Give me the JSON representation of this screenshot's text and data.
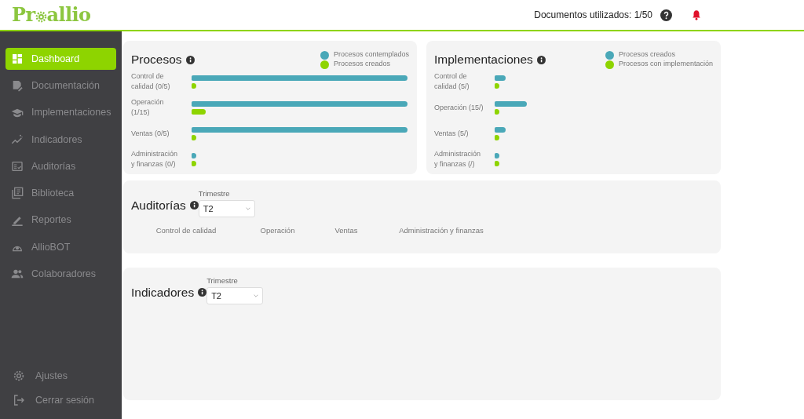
{
  "logo": {
    "before": "Pr",
    "after": "allio"
  },
  "header": {
    "documents": "Documentos utilizados: 1/50"
  },
  "sidebar": {
    "items": [
      {
        "label": "Dashboard",
        "selected": true
      },
      {
        "label": "Documentación",
        "selected": false
      },
      {
        "label": "Implementaciones",
        "selected": false
      },
      {
        "label": "Indicadores",
        "selected": false
      },
      {
        "label": "Auditorías",
        "selected": false
      },
      {
        "label": "Biblioteca",
        "selected": false
      },
      {
        "label": "Reportes",
        "selected": false
      },
      {
        "label": "AllioBOT",
        "selected": false
      },
      {
        "label": "Colaboradores",
        "selected": false
      }
    ],
    "bottom": [
      {
        "label": "Ajustes"
      },
      {
        "label": "Cerrar sesión"
      }
    ]
  },
  "procesos": {
    "title": "Procesos",
    "legend": [
      {
        "label": "Procesos contemplados",
        "color": "#4aa8b8"
      },
      {
        "label": "Procesos creados",
        "color": "#8ed400"
      }
    ],
    "rows": [
      "Control de calidad (0/5)",
      "Operación (1/15)",
      "Ventas (0/5)",
      "Administración y finanzas (0/)"
    ]
  },
  "implementaciones": {
    "title": "Implementaciones",
    "legend": [
      {
        "label": "Procesos creados",
        "color": "#4aa8b8"
      },
      {
        "label": "Procesos con implementación",
        "color": "#8ed400"
      }
    ],
    "rows": [
      "Control de calidad (5/)",
      "Operación (15/)",
      "Ventas (5/)",
      "Administración y finanzas (/)"
    ]
  },
  "auditorias": {
    "title": "Auditorías",
    "filter_label": "Trimestre",
    "filter_value": "T2",
    "columns": [
      "Control de calidad",
      "Operación",
      "Ventas",
      "Administración y finanzas"
    ]
  },
  "indicadores": {
    "title": "Indicadores",
    "filter_label": "Trimestre",
    "filter_value": "T2"
  }
}
